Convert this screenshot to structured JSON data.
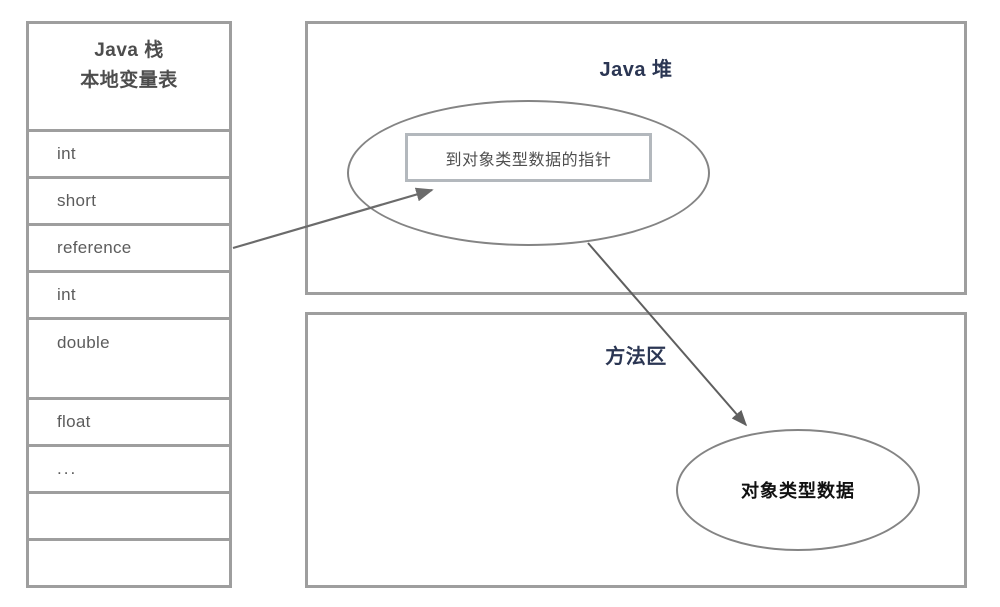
{
  "diagram": {
    "title_present": false,
    "colors": {
      "border_gray": "#9e9e9e",
      "ellipse_gray": "#848484",
      "region_title_navy": "#2b3653",
      "body_text_gray": "#5c5c5c",
      "header_text_gray": "#4d4d4d",
      "pointer_box_border": "#b3b8bd",
      "arrow_gray": "#6b6b6b",
      "background": "#ffffff"
    }
  },
  "stack": {
    "header": {
      "line1": "Java 栈",
      "line2": "本地变量表"
    },
    "rows": [
      {
        "label": "int"
      },
      {
        "label": "short"
      },
      {
        "label": "reference"
      },
      {
        "label": "int"
      },
      {
        "label": "double"
      },
      {
        "label": "float"
      },
      {
        "label": "..."
      },
      {
        "label": ""
      },
      {
        "label": ""
      }
    ]
  },
  "heap": {
    "title": "Java 堆",
    "ellipse": {
      "pointer_box_label": "到对象类型数据的指针"
    }
  },
  "method_area": {
    "title": "方法区",
    "ellipse": {
      "label": "对象类型数据"
    }
  },
  "arrows": [
    {
      "name": "reference-to-heap-object",
      "from": "reference row (Java stack)",
      "to": "pointer box in Java heap"
    },
    {
      "name": "heap-object-to-class-data",
      "from": "object in Java heap",
      "to": "object type data in method area"
    }
  ]
}
